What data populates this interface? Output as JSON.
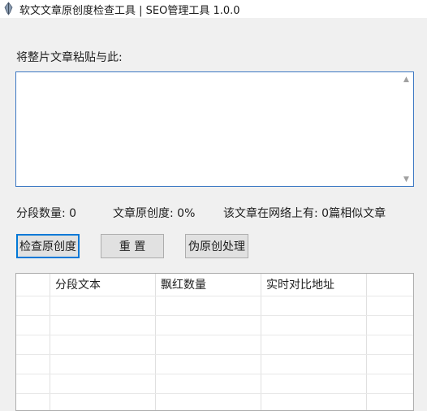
{
  "window": {
    "title": "软文文章原创度检查工具 | SEO管理工具  1.0.0",
    "icon": "feather-pen-icon"
  },
  "input_section": {
    "label": "将整片文章粘贴与此:",
    "textarea_value": ""
  },
  "stats": {
    "segments": "分段数量: 0",
    "originality": "文章原创度: 0%",
    "similar": "该文章在网络上有: 0篇相似文章"
  },
  "buttons": {
    "check": "检查原创度",
    "reset": "重 置",
    "pseudo": "伪原创处理"
  },
  "table": {
    "columns": [
      "",
      "分段文本",
      "飘红数量",
      "实时对比地址"
    ],
    "rows": []
  },
  "colors": {
    "accent": "#0078d7",
    "textarea_border": "#3c78c3",
    "window_bg": "#f0f0f0"
  }
}
